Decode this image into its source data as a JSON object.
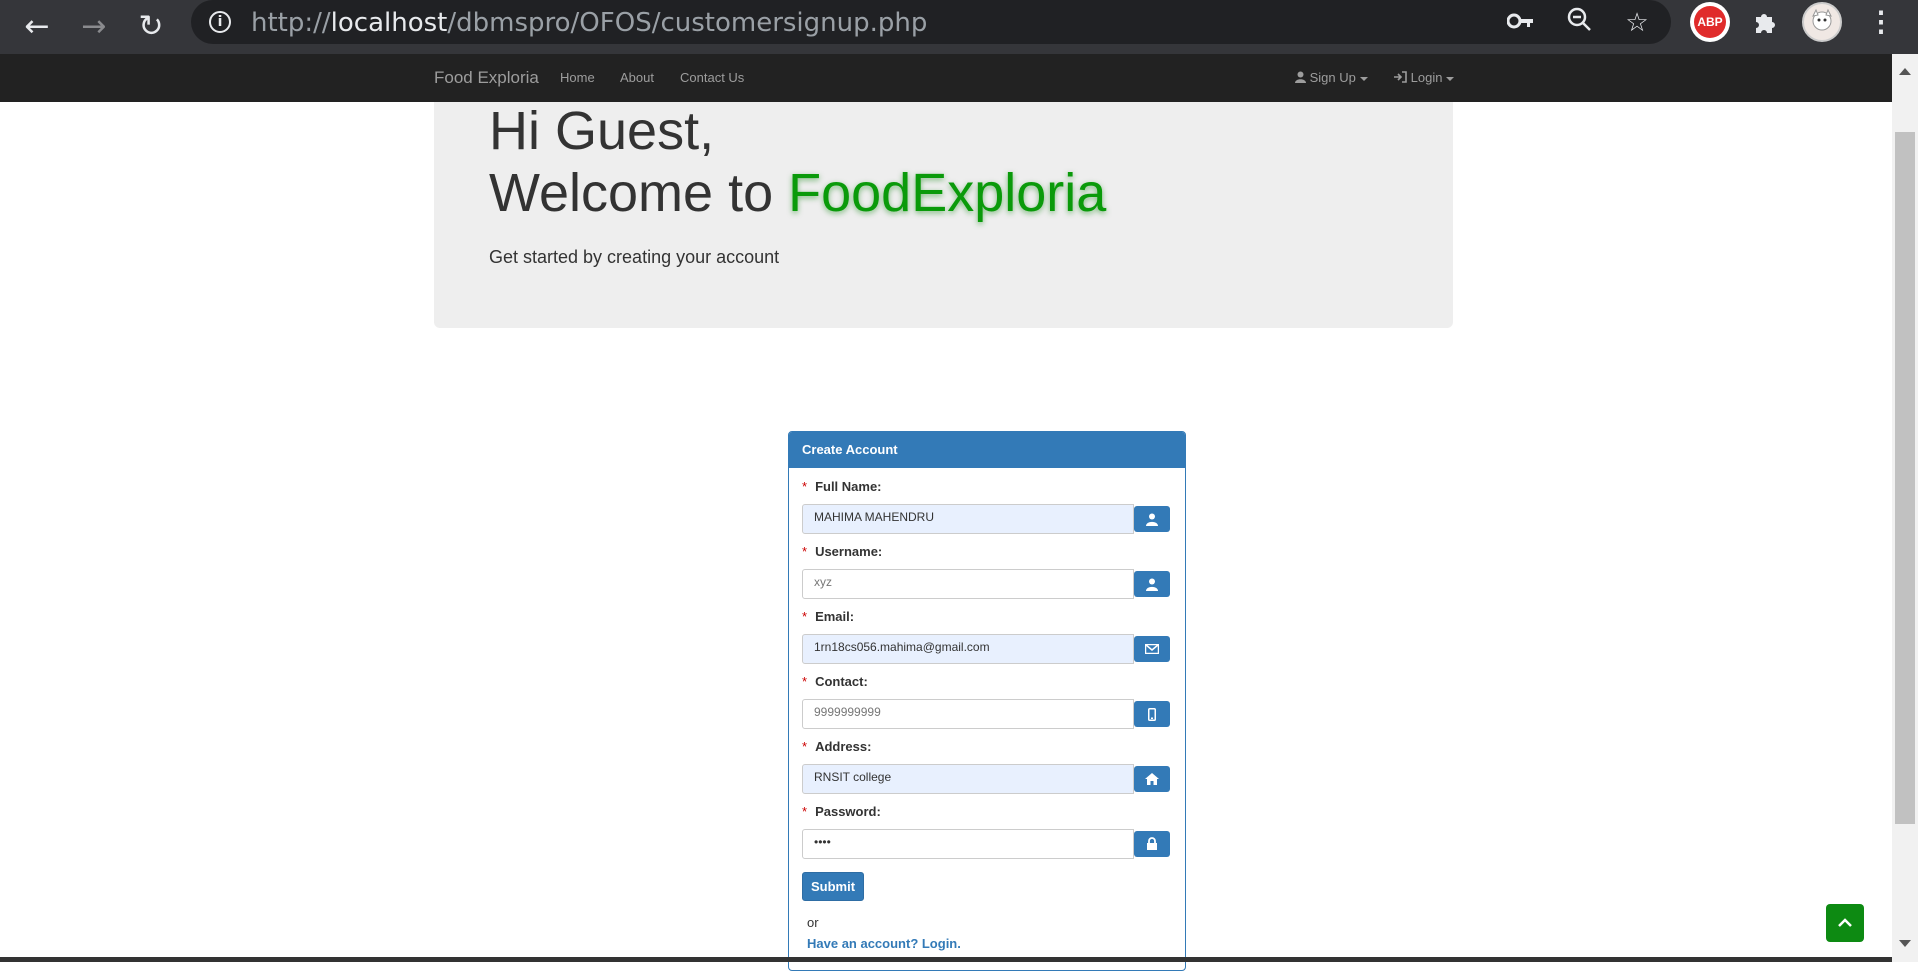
{
  "browser": {
    "url_scheme": "http://",
    "url_host": "localhost",
    "url_path": "/dbmspro/OFOS/customersignup.php",
    "abp_label": "ABP"
  },
  "navbar": {
    "brand": "Food Exploria",
    "links": [
      "Home",
      "About",
      "Contact Us"
    ],
    "signup": "Sign Up",
    "login": "Login"
  },
  "hero": {
    "line1": "Hi Guest,",
    "line2_prefix": "Welcome to ",
    "brand_name": "FoodExploria",
    "subtitle": "Get started by creating your account",
    "brand_color": "#0a9a0a"
  },
  "form": {
    "heading": "Create Account",
    "required_mark": "*",
    "fields": [
      {
        "label": "Full Name:",
        "value": "MAHIMA MAHENDRU",
        "icon": "user-icon"
      },
      {
        "label": "Username:",
        "value": "xyz",
        "icon": "user-icon"
      },
      {
        "label": "Email:",
        "value": "1rn18cs056.mahima@gmail.com",
        "icon": "envelope-icon"
      },
      {
        "label": "Contact:",
        "value": "9999999999",
        "icon": "phone-icon"
      },
      {
        "label": "Address:",
        "value": "RNSIT college",
        "icon": "home-icon"
      },
      {
        "label": "Password:",
        "value": "••••",
        "icon": "lock-icon"
      }
    ],
    "submit": "Submit",
    "or_text": "or",
    "login_link": "Have an account? Login."
  },
  "colors": {
    "primary": "#337ab7",
    "navbar_bg": "#222222",
    "scroll_top_button": "#0d8a12"
  }
}
